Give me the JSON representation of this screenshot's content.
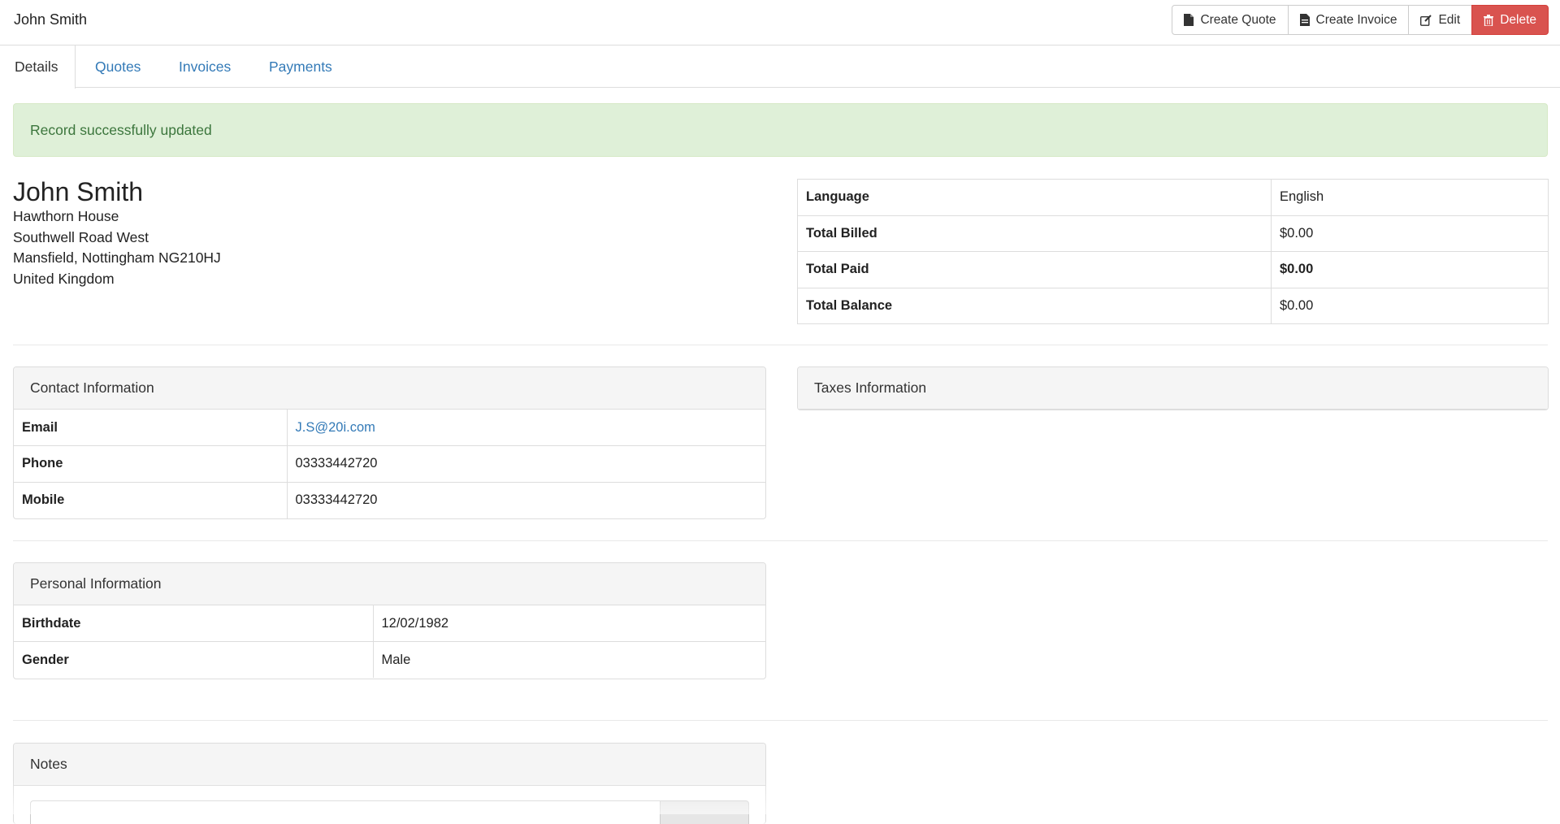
{
  "header": {
    "title": "John Smith",
    "buttons": {
      "create_quote": "Create Quote",
      "create_invoice": "Create Invoice",
      "edit": "Edit",
      "delete": "Delete"
    }
  },
  "tabs": [
    "Details",
    "Quotes",
    "Invoices",
    "Payments"
  ],
  "alert": "Record successfully updated",
  "client": {
    "name": "John Smith",
    "address": [
      "Hawthorn House",
      "Southwell Road West",
      "Mansfield, Nottingham NG210HJ",
      "United Kingdom"
    ]
  },
  "summary": [
    {
      "label": "Language",
      "value": "English"
    },
    {
      "label": "Total Billed",
      "value": "$0.00"
    },
    {
      "label": "Total Paid",
      "value": "$0.00"
    },
    {
      "label": "Total Balance",
      "value": "$0.00"
    }
  ],
  "contact": {
    "heading": "Contact Information",
    "rows": [
      {
        "label": "Email",
        "value": "J.S@20i.com"
      },
      {
        "label": "Phone",
        "value": "03333442720"
      },
      {
        "label": "Mobile",
        "value": "03333442720"
      }
    ]
  },
  "taxes": {
    "heading": "Taxes Information"
  },
  "personal": {
    "heading": "Personal Information",
    "rows": [
      {
        "label": "Birthdate",
        "value": "12/02/1982"
      },
      {
        "label": "Gender",
        "value": "Male"
      }
    ]
  },
  "notes": {
    "heading": "Notes"
  },
  "colors": {
    "link": "#337ab7",
    "danger": "#d9534f",
    "success_bg": "#dff0d8",
    "success_text": "#3c763d"
  },
  "icons": {
    "create_quote": "file-icon",
    "create_invoice": "file-text-icon",
    "edit": "edit-icon",
    "delete": "trash-icon"
  }
}
